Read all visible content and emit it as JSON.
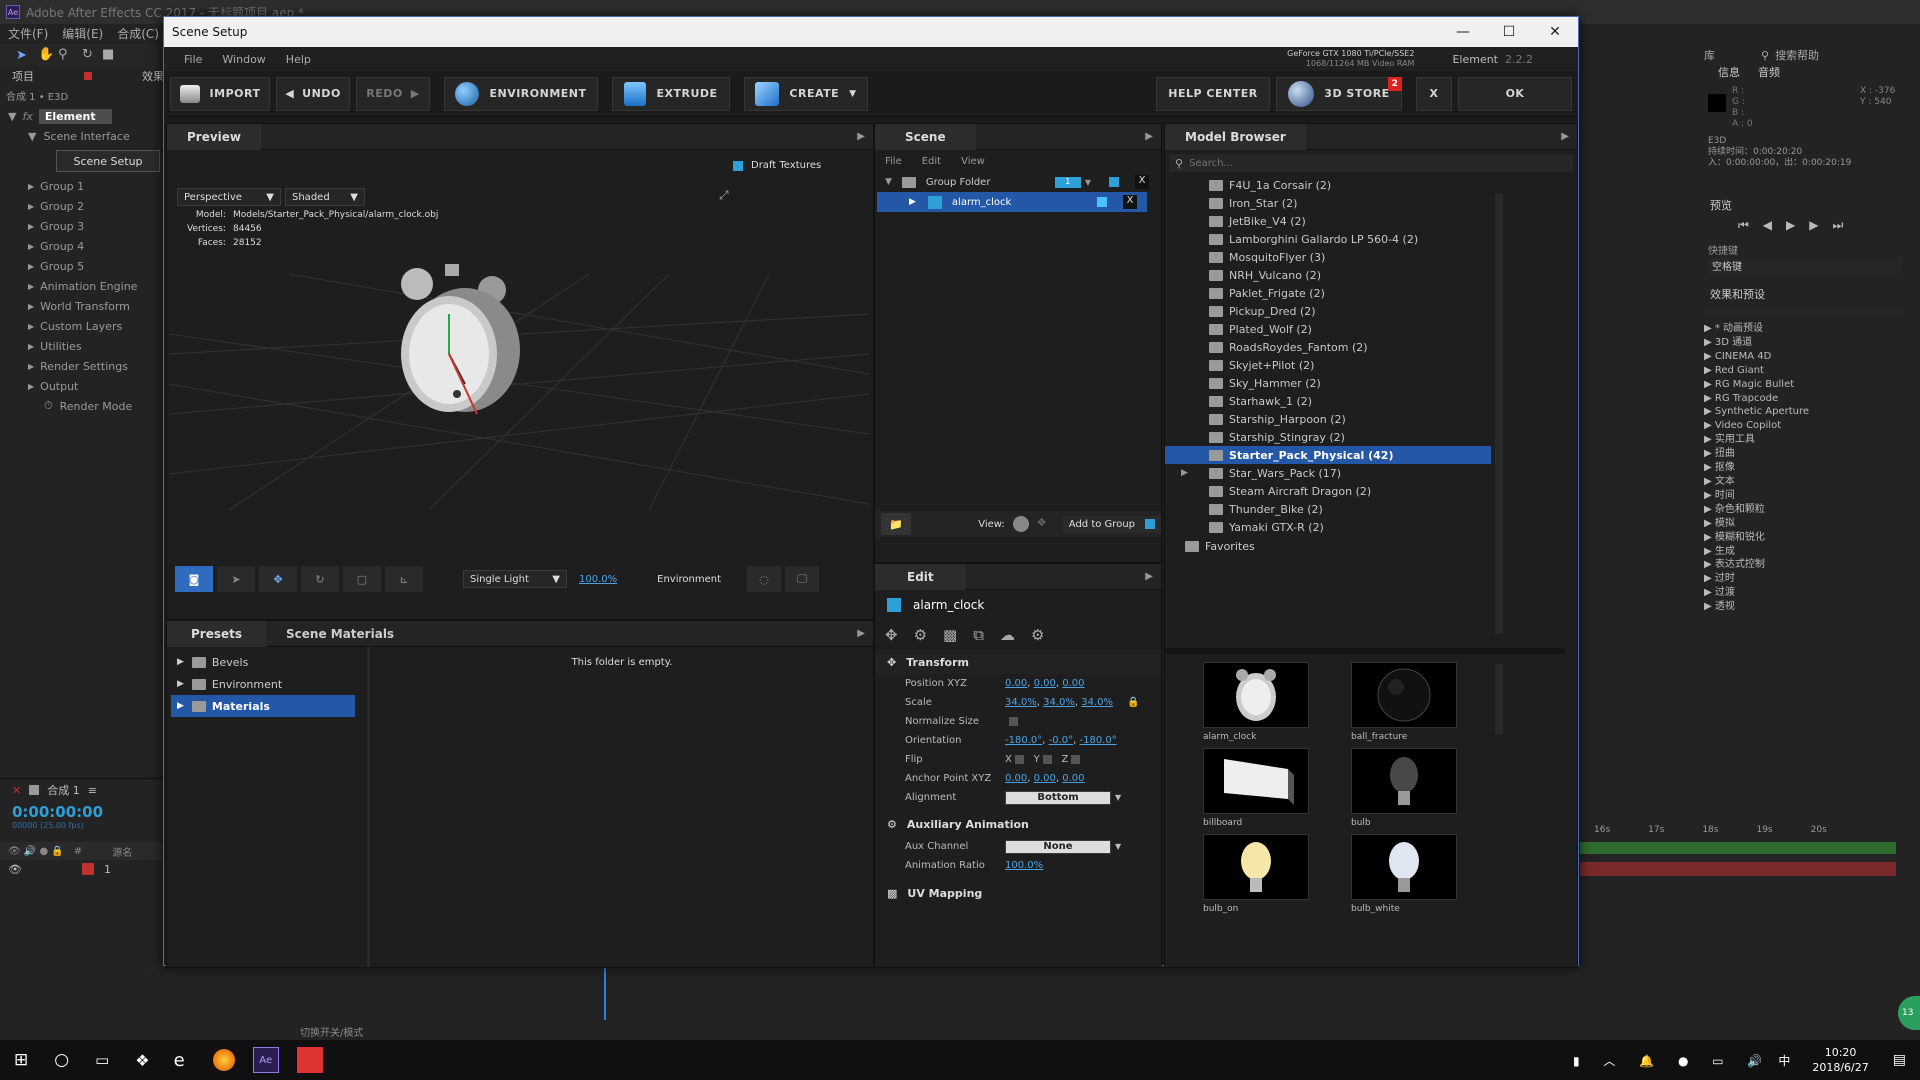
{
  "ae": {
    "title": "Adobe After Effects CC 2017 - 无标题项目.aep *",
    "menu": [
      "文件(F)",
      "编辑(E)",
      "合成(C)"
    ],
    "project_label": "项目",
    "effects_label": "效果",
    "comp_label": "合成 1 • E3D",
    "fx_label": "fx",
    "element_label": "Element",
    "scene_interface": "Scene Interface",
    "scene_setup_btn": "Scene Setup",
    "groups": [
      "Group 1",
      "Group 2",
      "Group 3",
      "Group 4",
      "Group 5",
      "Animation Engine",
      "World Transform",
      "Custom Layers",
      "Utilities",
      "Render Settings",
      "Output"
    ],
    "render_mode": "Render Mode",
    "timeline_comp": "合成 1",
    "timecode": "0:00:00:00",
    "timecode_sub": "00000 (25.00 fps)",
    "layer_num": "1",
    "source_label": "源名",
    "toggle_label": "切换开关/模式",
    "help_search": "搜索帮助",
    "library_tab": "库",
    "info_tab": "信息",
    "audio_tab": "音频",
    "info_rgb": [
      "R :",
      "G :",
      "B :",
      "A : 0"
    ],
    "info_xy": [
      "X : -376",
      "Y : 540"
    ],
    "e3d_label": "E3D",
    "duration": "持续时间：0:00:20:20",
    "inout": "入：0:00:00:00，出：0:00:20:19",
    "preview_tab": "预览",
    "shortcut_label": "快捷键",
    "shortcut_val": "空格键",
    "effects_presets": "效果和预设",
    "effects_list": [
      "* 动画预设",
      "3D 通道",
      "CINEMA 4D",
      "Red Giant",
      "RG Magic Bullet",
      "RG Trapcode",
      "Synthetic Aperture",
      "Video Copilot",
      "实用工具",
      "扭曲",
      "抠像",
      "文本",
      "时间",
      "杂色和颗粒",
      "模拟",
      "模糊和锐化",
      "生成",
      "表达式控制",
      "过时",
      "过渡",
      "透视"
    ],
    "ruler": [
      "16s",
      "17s",
      "18s",
      "19s",
      "20s"
    ]
  },
  "window": {
    "title": "Scene Setup",
    "menu": [
      "File",
      "Window",
      "Help"
    ],
    "gpu": "GeForce GTX 1080 Ti/PCIe/SSE2",
    "vram": "1068/11264 MB Video RAM",
    "element_label": "Element",
    "version": "2.2.2"
  },
  "toolbar": {
    "import": "IMPORT",
    "undo": "UNDO",
    "redo": "REDO",
    "environment": "ENVIRONMENT",
    "extrude": "EXTRUDE",
    "create": "CREATE",
    "help_center": "HELP CENTER",
    "store": "3D STORE",
    "store_badge": "2",
    "close": "X",
    "ok": "OK"
  },
  "preview": {
    "tab": "Preview",
    "draft_textures": "Draft Textures",
    "camera": "Perspective",
    "shading": "Shaded",
    "model_label": "Model:",
    "model_path": "Models/Starter_Pack_Physical/alarm_clock.obj",
    "vertices_label": "Vertices:",
    "vertices": "84456",
    "faces_label": "Faces:",
    "faces": "28152",
    "light": "Single Light",
    "zoom": "100.0%",
    "environment": "Environment"
  },
  "scene": {
    "tab": "Scene",
    "menu": [
      "File",
      "Edit",
      "View"
    ],
    "group_folder": "Group Folder",
    "group_num": "1",
    "item": "alarm_clock",
    "view_label": "View:",
    "add_to_group": "Add to Group"
  },
  "presets": {
    "tabs": [
      "Presets",
      "Scene Materials"
    ],
    "items": [
      "Bevels",
      "Environment",
      "Materials"
    ],
    "empty": "This folder is empty."
  },
  "edit": {
    "tab": "Edit",
    "object": "alarm_clock",
    "transform": "Transform",
    "position_label": "Position XYZ",
    "position": [
      "0.00",
      "0.00",
      "0.00"
    ],
    "scale_label": "Scale",
    "scale": [
      "34.0%",
      "34.0%",
      "34.0%"
    ],
    "normalize_label": "Normalize Size",
    "orientation_label": "Orientation",
    "orientation": [
      "-180.0°",
      "-0.0°",
      "-180.0°"
    ],
    "flip_label": "Flip",
    "flip_axes": [
      "X",
      "Y",
      "Z"
    ],
    "anchor_label": "Anchor Point XYZ",
    "anchor": [
      "0.00",
      "0.00",
      "0.00"
    ],
    "alignment_label": "Alignment",
    "alignment": "Bottom",
    "aux_anim": "Auxiliary Animation",
    "aux_channel_label": "Aux Channel",
    "aux_channel": "None",
    "anim_ratio_label": "Animation Ratio",
    "anim_ratio": "100.0%",
    "uv_mapping": "UV Mapping"
  },
  "model_browser": {
    "tab": "Model Browser",
    "search_placeholder": "Search...",
    "items": [
      "F4U_1a Corsair (2)",
      "Iron_Star (2)",
      "JetBike_V4 (2)",
      "Lamborghini Gallardo LP 560-4 (2)",
      "MosquitoFlyer (3)",
      "NRH_Vulcano (2)",
      "Paklet_Frigate (2)",
      "Pickup_Dred (2)",
      "Plated_Wolf (2)",
      "RoadsRoydes_Fantom (2)",
      "Skyjet+Pilot (2)",
      "Sky_Hammer (2)",
      "Starhawk_1 (2)",
      "Starship_Harpoon (2)",
      "Starship_Stingray (2)",
      "Starter_Pack_Physical (42)",
      "Star_Wars_Pack (17)",
      "Steam Aircraft Dragon (2)",
      "Thunder_Bike (2)",
      "Yamaki GTX-R (2)"
    ],
    "selected_index": 15,
    "favorites": "Favorites",
    "thumbs": [
      "alarm_clock",
      "ball_fracture",
      "billboard",
      "bulb",
      "bulb_on",
      "bulb_white"
    ]
  },
  "taskbar": {
    "time": "10:20",
    "date": "2018/6/27",
    "ime": "中",
    "notif": "13"
  }
}
